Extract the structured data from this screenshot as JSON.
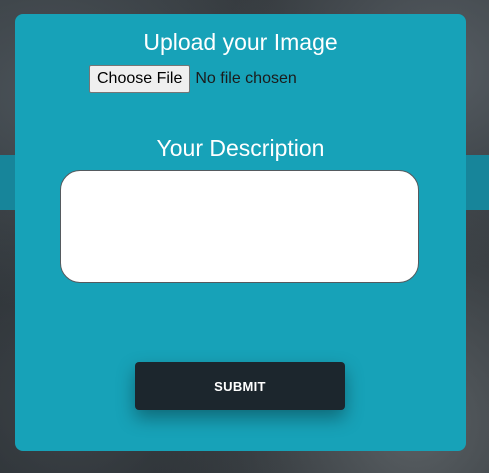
{
  "form": {
    "upload_title": "Upload your Image",
    "choose_file_label": "Choose File",
    "file_status": "No file chosen",
    "description_title": "Your Description",
    "description_value": "",
    "submit_label": "SUBMIT"
  },
  "colors": {
    "panel": "#17a2b8",
    "submit_button": "#1c262d",
    "text_light": "#ffffff"
  }
}
